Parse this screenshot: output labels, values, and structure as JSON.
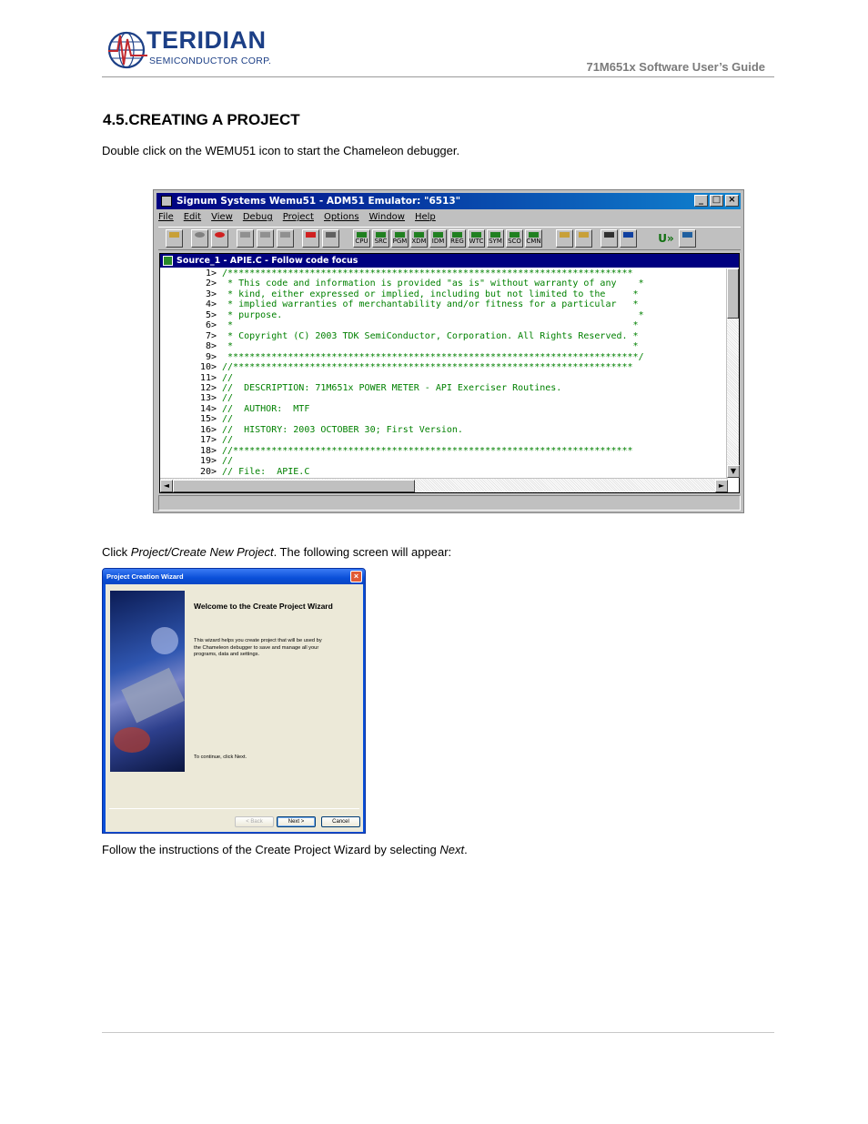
{
  "header": {
    "logo_name": "TERIDIAN",
    "logo_tagline": "SEMICONDUCTOR CORP.",
    "doc_title": "71M651x Software User’s Guide"
  },
  "section": {
    "heading": "4.5.CREATING A PROJECT",
    "intro": "Double click on the WEMU51 icon to start the Chameleon debugger.",
    "click_prefix": "Click ",
    "click_menu": "Project/Create New Project",
    "click_suffix": ". The following screen will appear:",
    "follow_prefix": "Follow the instructions of the Create Project Wizard by selecting ",
    "follow_link": "Next",
    "follow_suffix": "."
  },
  "emulator": {
    "title": "Signum Systems Wemu51 - ADM51 Emulator: \"6513\"",
    "menus": [
      "File",
      "Edit",
      "View",
      "Debug",
      "Project",
      "Options",
      "Window",
      "Help"
    ],
    "toolbar_labels": [
      "CPU",
      "SRC",
      "PGM",
      "XDM",
      "IDM",
      "REG",
      "WTC",
      "SYM",
      "SCO",
      "CMN"
    ],
    "source_title": "Source_1 - APIE.C - Follow code focus",
    "code_lines": [
      {
        "n": "1>",
        "t": "/**************************************************************************"
      },
      {
        "n": "2>",
        "t": " * This code and information is provided \"as is\" without warranty of any    *"
      },
      {
        "n": "3>",
        "t": " * kind, either expressed or implied, including but not limited to the     *"
      },
      {
        "n": "4>",
        "t": " * implied warranties of merchantability and/or fitness for a particular   *"
      },
      {
        "n": "5>",
        "t": " * purpose.                                                                 *"
      },
      {
        "n": "6>",
        "t": " *                                                                         *"
      },
      {
        "n": "7>",
        "t": " * Copyright (C) 2003 TDK SemiConductor, Corporation. All Rights Reserved. *"
      },
      {
        "n": "8>",
        "t": " *                                                                         *"
      },
      {
        "n": "9>",
        "t": " ***************************************************************************/"
      },
      {
        "n": "10>",
        "t": "//*************************************************************************"
      },
      {
        "n": "11>",
        "t": "//"
      },
      {
        "n": "12>",
        "t": "//  DESCRIPTION: 71M651x POWER METER - API Exerciser Routines."
      },
      {
        "n": "13>",
        "t": "//"
      },
      {
        "n": "14>",
        "t": "//  AUTHOR:  MTF"
      },
      {
        "n": "15>",
        "t": "//"
      },
      {
        "n": "16>",
        "t": "//  HISTORY: 2003 OCTOBER 30; First Version."
      },
      {
        "n": "17>",
        "t": "//"
      },
      {
        "n": "18>",
        "t": "//*************************************************************************"
      },
      {
        "n": "19>",
        "t": "//"
      },
      {
        "n": "20>",
        "t": "// File:  APIE.C"
      }
    ]
  },
  "wizard": {
    "title": "Project Creation Wizard",
    "heading": "Welcome to the Create Project Wizard",
    "description": "This wizard helps you create project that will be used by the Chameleon debugger to save and manage all your programs, data and settings.",
    "continue_text": "To continue, click Next.",
    "back_label": "< Back",
    "next_label": "Next >",
    "cancel_label": "Cancel"
  }
}
